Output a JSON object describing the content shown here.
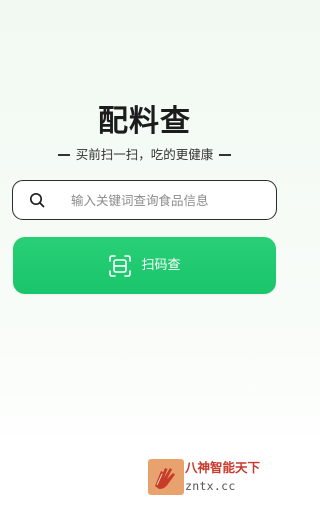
{
  "app": {
    "title": "配料查",
    "slogan": "买前扫一扫，吃的更健康"
  },
  "search": {
    "placeholder": "输入关键词查询食品信息",
    "value": "",
    "icon": "search-icon"
  },
  "scan": {
    "label": "扫码查",
    "icon": "scan-icon"
  },
  "watermark": {
    "site_name": "八神智能天下",
    "domain": "zntx.cc",
    "icon": "hand-logo-icon"
  },
  "colors": {
    "accent": "#22c96f",
    "title": "#1c1c1c",
    "watermark_red": "#c83a2c",
    "background_top": "#f1f9f2"
  }
}
